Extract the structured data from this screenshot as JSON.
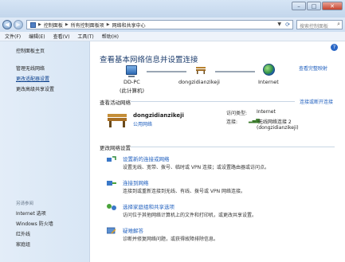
{
  "window": {
    "minimize_glyph": "–",
    "maximize_glyph": "□",
    "close_glyph": "✕"
  },
  "address": {
    "crumbs": [
      "控制面板",
      "所有控制面板项",
      "网络和共享中心"
    ],
    "search_placeholder": "搜索控制面板"
  },
  "menu": {
    "file": "文件(F)",
    "edit": "编辑(E)",
    "view": "查看(V)",
    "tools": "工具(T)",
    "help": "帮助(H)"
  },
  "sidebar": {
    "home": "控制面板主页",
    "items": [
      "管理无线网络",
      "更改适配器设置",
      "更改高级共享设置"
    ],
    "see_also_heading": "另请参阅",
    "see_also": [
      "Internet 选项",
      "Windows 防火墙",
      "红外线",
      "家庭组"
    ]
  },
  "main": {
    "title": "查看基本网络信息并设置连接",
    "full_map": "查看完整映射",
    "map": {
      "pc_name": "DD-PC",
      "pc_sub": "(此计算机)",
      "network_name": "dongzidianzikeji",
      "internet": "Internet"
    },
    "active_heading": "查看活动网络",
    "disconnect": "连接或断开连接",
    "active": {
      "name": "dongzidianzikeji",
      "type": "公用网络",
      "access_label": "访问类型:",
      "access_value": "Internet",
      "conn_label": "连接:",
      "conn_value": "无线网络连接 2",
      "conn_value_sub": "(dongzidianzikeji)"
    },
    "change_heading": "更改网络设置",
    "tasks": [
      {
        "title": "设置新的连接或网络",
        "desc": "设置无线、宽带、拨号、临时或 VPN 连接；或设置路由器或访问点。"
      },
      {
        "title": "连接到网络",
        "desc": "连接到或重新连接到无线、有线、拨号或 VPN 网络连接。"
      },
      {
        "title": "选择家庭组和共享选项",
        "desc": "访问位于其他网络计算机上的文件和打印机，或更改共享设置。"
      },
      {
        "title": "疑难解答",
        "desc": "诊断并修复网络问题，或获得故障排除信息。"
      }
    ]
  },
  "colors": {
    "link": "#1f5fbe",
    "title": "#1e3e6e",
    "sidebar_bg": "#dbe8f6"
  }
}
